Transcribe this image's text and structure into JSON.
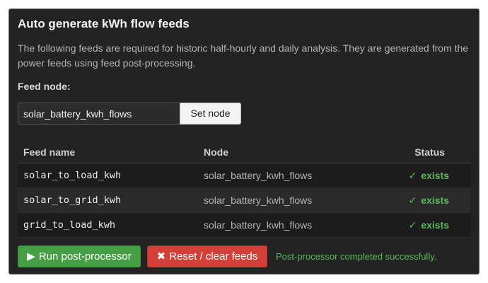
{
  "panel": {
    "title": "Auto generate kWh flow feeds",
    "description": "The following feeds are required for historic half-hourly and daily analysis. They are generated from the power feeds using feed post-processing."
  },
  "feed_node": {
    "label": "Feed node:",
    "value": "solar_battery_kwh_flows",
    "set_button_label": "Set node"
  },
  "table": {
    "headers": {
      "name": "Feed name",
      "node": "Node",
      "status": "Status"
    },
    "rows": [
      {
        "name": "solar_to_load_kwh",
        "node": "solar_battery_kwh_flows",
        "status_icon": "✓",
        "status": "exists"
      },
      {
        "name": "solar_to_grid_kwh",
        "node": "solar_battery_kwh_flows",
        "status_icon": "✓",
        "status": "exists"
      },
      {
        "name": "grid_to_load_kwh",
        "node": "solar_battery_kwh_flows",
        "status_icon": "✓",
        "status": "exists"
      }
    ]
  },
  "actions": {
    "run_icon": "▶",
    "run_label": "Run post-processor",
    "reset_icon": "✖",
    "reset_label": "Reset / clear feeds",
    "status_message": "Post-processor completed successfully."
  },
  "colors": {
    "panel_bg": "#232323",
    "success": "#5cb85c",
    "run_button": "#45a045",
    "reset_button": "#d43f3a"
  }
}
